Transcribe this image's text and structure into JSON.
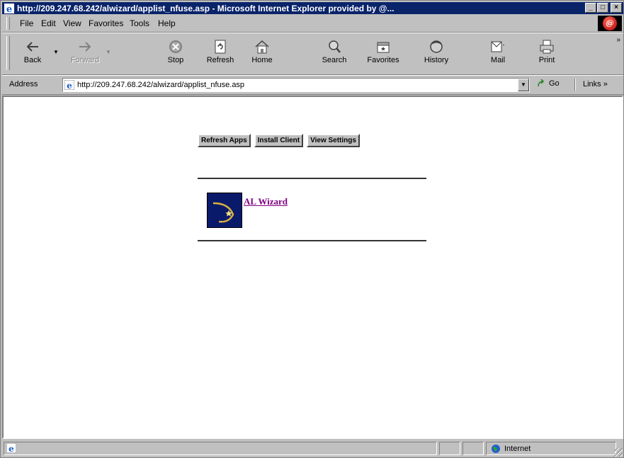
{
  "window": {
    "title": "http://209.247.68.242/alwizard/applist_nfuse.asp - Microsoft Internet Explorer provided by @...",
    "buttons": {
      "minimize": "_",
      "maximize": "□",
      "close": "×"
    }
  },
  "menu": {
    "items": [
      "File",
      "Edit",
      "View",
      "Favorites",
      "Tools",
      "Help"
    ],
    "logo_letter": "@"
  },
  "toolbar": {
    "back": "Back",
    "forward": "Forward",
    "stop": "Stop",
    "refresh": "Refresh",
    "home": "Home",
    "search": "Search",
    "favorites": "Favorites",
    "history": "History",
    "mail": "Mail",
    "print": "Print",
    "more": "»"
  },
  "address_bar": {
    "label": "Address",
    "url": "http://209.247.68.242/alwizard/applist_nfuse.asp",
    "go": "Go",
    "links": "Links »"
  },
  "page": {
    "buttons": {
      "refresh_apps": "Refresh Apps",
      "install_client": "Install Client",
      "view_settings": "View Settings"
    },
    "app": {
      "name": "AL Wizard",
      "icon": "al-wizard-app-icon",
      "link_color": "#800080"
    }
  },
  "status_bar": {
    "zone": "Internet"
  },
  "colors": {
    "title_bar": "#0a246a",
    "chrome": "#c0c0c0",
    "app_tile": "#0a1a6a"
  }
}
